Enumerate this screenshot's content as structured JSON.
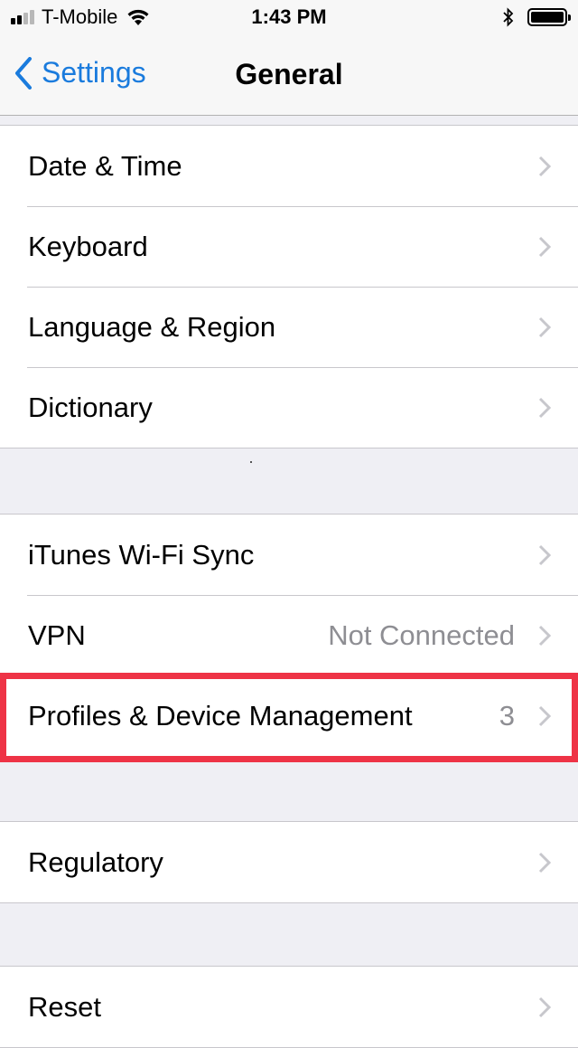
{
  "status_bar": {
    "carrier": "T-Mobile",
    "time": "1:43 PM",
    "signal_bars_active": 2,
    "signal_bars_total": 4,
    "battery_level": 1.0
  },
  "nav": {
    "back_label": "Settings",
    "title": "General"
  },
  "groups": [
    {
      "rows": [
        {
          "label": "Date & Time"
        },
        {
          "label": "Keyboard"
        },
        {
          "label": "Language & Region"
        },
        {
          "label": "Dictionary"
        }
      ]
    },
    {
      "rows": [
        {
          "label": "iTunes Wi-Fi Sync"
        },
        {
          "label": "VPN",
          "value": "Not Connected"
        },
        {
          "label": "Profiles & Device Management",
          "value": "3"
        }
      ]
    },
    {
      "rows": [
        {
          "label": "Regulatory"
        }
      ]
    },
    {
      "rows": [
        {
          "label": "Reset"
        }
      ]
    }
  ],
  "colors": {
    "accent": "#1a7bdd",
    "highlight": "#ee3346",
    "background": "#efeff4"
  }
}
